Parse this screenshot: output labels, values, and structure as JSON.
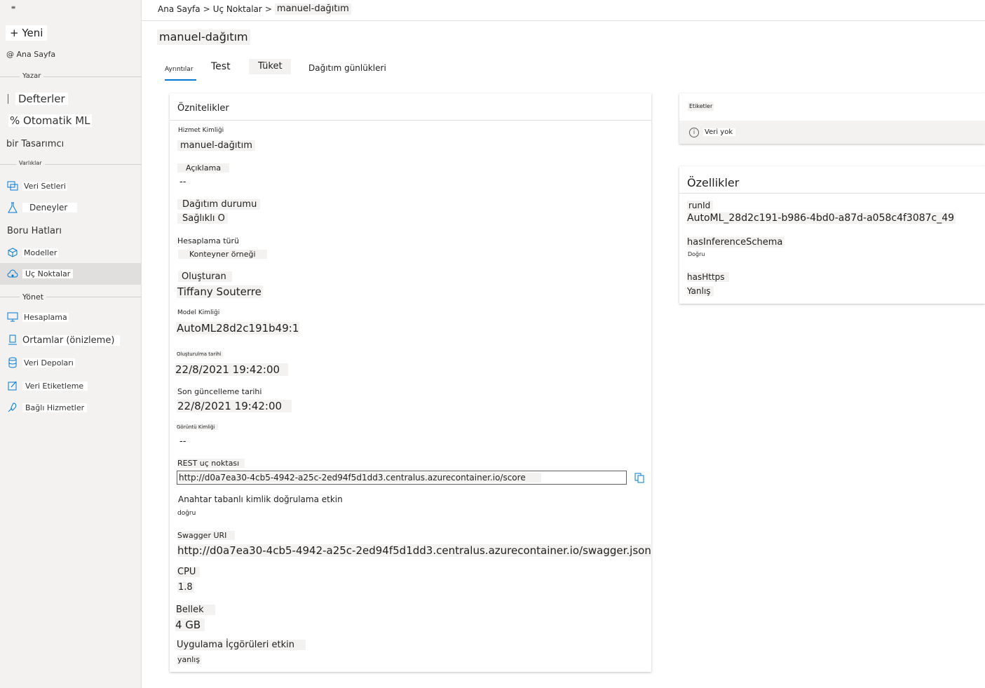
{
  "sidebar": {
    "menu_glyph": "≡",
    "new_label": "+ Yeni",
    "home_label": "@ Ana Sayfa",
    "sections": {
      "author": "Yazar",
      "assets": "Varlıklar",
      "manage": "Yönet"
    },
    "items": {
      "notebooks": "Defterler",
      "automl": "% Otomatik ML",
      "designer": "bir Tasarımcı",
      "datasets": "Veri Setleri",
      "experiments": "Deneyler",
      "pipelines": "Boru Hatları",
      "models": "Modeller",
      "endpoints": "Uç Noktalar",
      "compute": "Hesaplama",
      "environments": "Ortamlar (önizleme)",
      "datastores": "Veri Depoları",
      "data_labeling": "Veri Etiketleme",
      "linked_services": "Bağlı Hizmetler"
    },
    "icons": {
      "datasets": "dataset-icon",
      "experiments": "flask-icon",
      "models": "cube-icon",
      "endpoints": "cloud-endpoint-icon",
      "compute": "monitor-icon",
      "environments": "environment-icon",
      "datastores": "database-icon",
      "data_labeling": "edit-icon",
      "linked_services": "link-icon"
    },
    "accent_color": "#0078d4"
  },
  "breadcrumb": {
    "home": "Ana Sayfa",
    "sep1": ">",
    "endpoints": "Uç Noktalar",
    "sep2": ">",
    "current": "manuel-dağıtım"
  },
  "page_title": "manuel-dağıtım",
  "tabs": {
    "details": "Ayrıntılar",
    "test": "Test",
    "consume": "Tüket",
    "logs": "Dağıtım günlükleri"
  },
  "attributes": {
    "title": "Öznitelikler",
    "service_id_label": "Hizmet Kimliği",
    "service_id_value": "manuel-dağıtım",
    "description_label": "Açıklama",
    "description_value": "--",
    "deploy_state_label": "Dağıtım durumu",
    "deploy_state_value": "Sağlıklı O",
    "compute_type_label": "Hesaplama türü",
    "compute_type_value": "Konteyner örneği",
    "created_by_label": "Oluşturan",
    "created_by_value": "Tiffany Souterre",
    "model_id_label": "Model Kimliği",
    "model_id_value": "AutoML28d2c191b49:1",
    "created_on_label": "Oluşturulma tarihi",
    "created_on_value": "22/8/2021 19:42:00",
    "updated_on_label": "Son güncelleme tarihi",
    "updated_on_value": "22/8/2021 19:42:00",
    "image_id_label": "Görüntü Kimliği",
    "image_id_value": "--",
    "rest_label": "REST uç noktası",
    "rest_value": "http://d0a7ea30-4cb5-4942-a25c-2ed94f5d1dd3.centralus.azurecontainer.io/score",
    "key_auth_label": "Anahtar tabanlı kimlik doğrulama etkin",
    "key_auth_value": "doğru",
    "swagger_label": "Swagger URI",
    "swagger_value": "http://d0a7ea30-4cb5-4942-a25c-2ed94f5d1dd3.centralus.azurecontainer.io/swagger.json",
    "cpu_label": "CPU",
    "cpu_value": "1.8",
    "memory_label": "Bellek",
    "memory_value": "4 GB",
    "appinsights_label": "Uygulama İçgörüleri etkin",
    "appinsights_value": "yanlış"
  },
  "tags": {
    "title": "Etiketler",
    "empty": "Veri yok"
  },
  "properties": {
    "title": "Özellikler",
    "runid_label": "runId",
    "runid_value": "AutoML_28d2c191-b986-4bd0-a87d-a058c4f3087c_49",
    "schema_label": "hasInferenceSchema",
    "schema_value": "Doğru",
    "https_label": "hasHttps",
    "https_value": "Yanlış"
  }
}
